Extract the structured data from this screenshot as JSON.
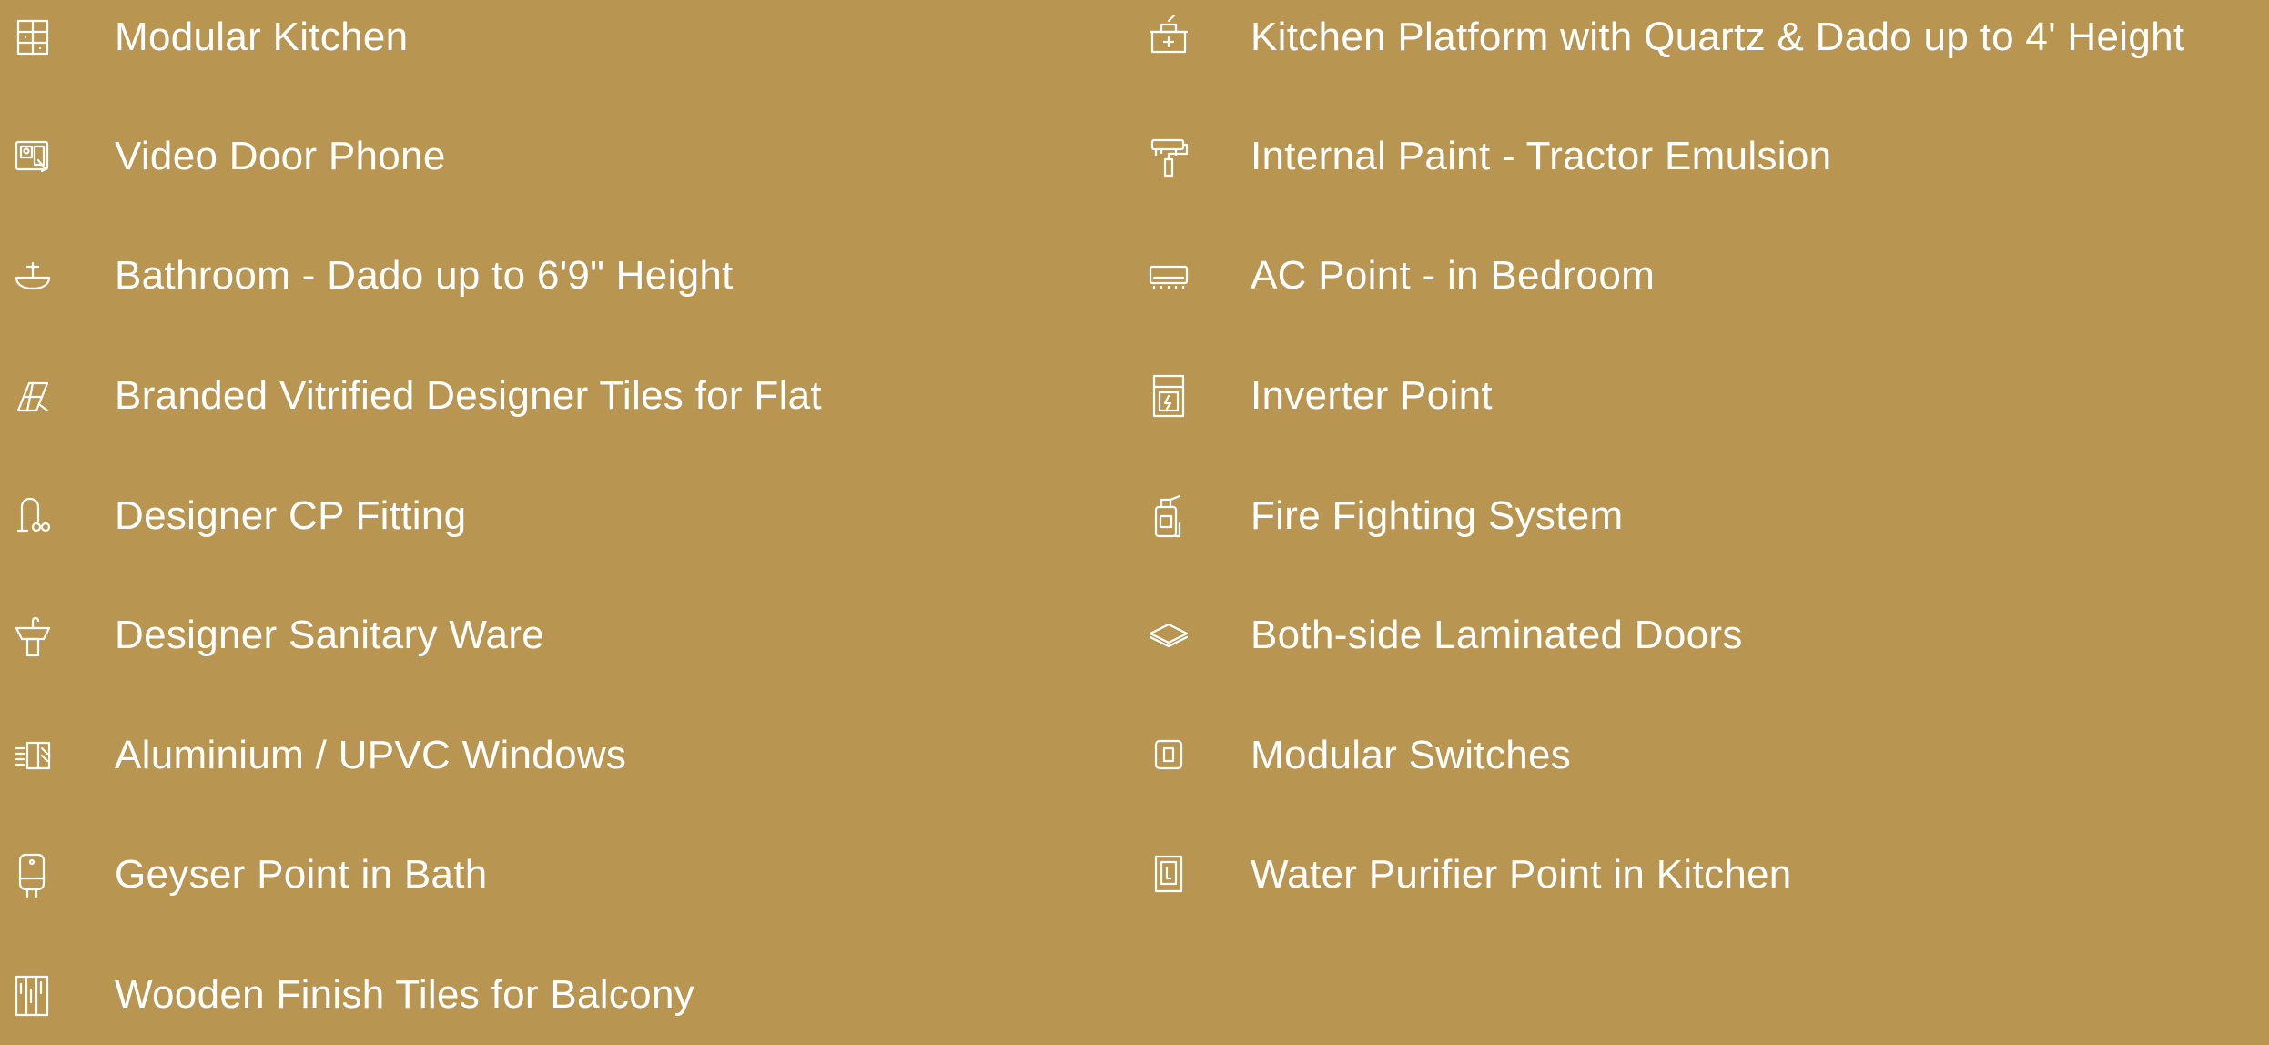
{
  "background_color": "#B89550",
  "text_color": "#FFFFFF",
  "left_items": [
    {
      "label": "Modular Kitchen",
      "icon": "modular-kitchen-icon"
    },
    {
      "label": "Video Door Phone",
      "icon": "video-door-phone-icon"
    },
    {
      "label": "Bathroom - Dado up to 6'9\" Height",
      "icon": "bathroom-sink-icon"
    },
    {
      "label": "Branded Vitrified Designer Tiles for Flat",
      "icon": "tiles-icon"
    },
    {
      "label": "Designer CP Fitting",
      "icon": "cp-fitting-tap-icon"
    },
    {
      "label": "Designer Sanitary Ware",
      "icon": "wash-basin-icon"
    },
    {
      "label": "Aluminium / UPVC Windows",
      "icon": "window-icon"
    },
    {
      "label": "Geyser Point in Bath",
      "icon": "geyser-icon"
    },
    {
      "label": "Wooden Finish Tiles for Balcony",
      "icon": "wooden-tiles-icon"
    }
  ],
  "right_items": [
    {
      "label": "Kitchen Platform with Quartz & Dado up to 4' Height",
      "icon": "kitchen-platform-icon"
    },
    {
      "label": "Internal Paint - Tractor Emulsion",
      "icon": "paint-roller-icon"
    },
    {
      "label": "AC Point - in Bedroom",
      "icon": "air-conditioner-icon"
    },
    {
      "label": "Inverter Point",
      "icon": "inverter-icon"
    },
    {
      "label": "Fire Fighting System",
      "icon": "fire-extinguisher-icon"
    },
    {
      "label": "Both-side Laminated Doors",
      "icon": "laminate-sheet-icon"
    },
    {
      "label": "Modular Switches",
      "icon": "switch-icon"
    },
    {
      "label": "Water Purifier Point in Kitchen",
      "icon": "water-purifier-icon"
    }
  ]
}
